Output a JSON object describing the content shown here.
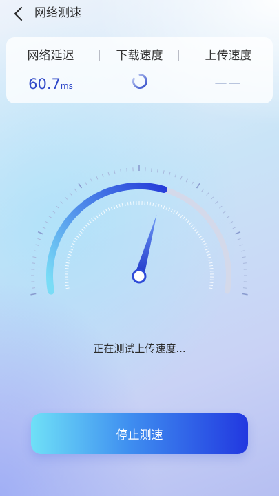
{
  "header": {
    "back_icon": "chevron-left-icon",
    "title": "网络测速"
  },
  "stats": {
    "latency": {
      "label": "网络延迟",
      "value": "60.7",
      "unit": "ms"
    },
    "download": {
      "label": "下载速度",
      "state": "loading",
      "icon": "loading-spinner-icon"
    },
    "upload": {
      "label": "上传速度",
      "value": "——"
    }
  },
  "gauge": {
    "progress_fraction": 0.58,
    "needle_fraction": 0.58
  },
  "status_text": "正在测试上传速度...",
  "stop_button_label": "停止测速",
  "colors": {
    "accent": "#2f48c8",
    "button_start": "#6fe0f7",
    "button_end": "#2238e0",
    "track": "#d4d9ea"
  }
}
